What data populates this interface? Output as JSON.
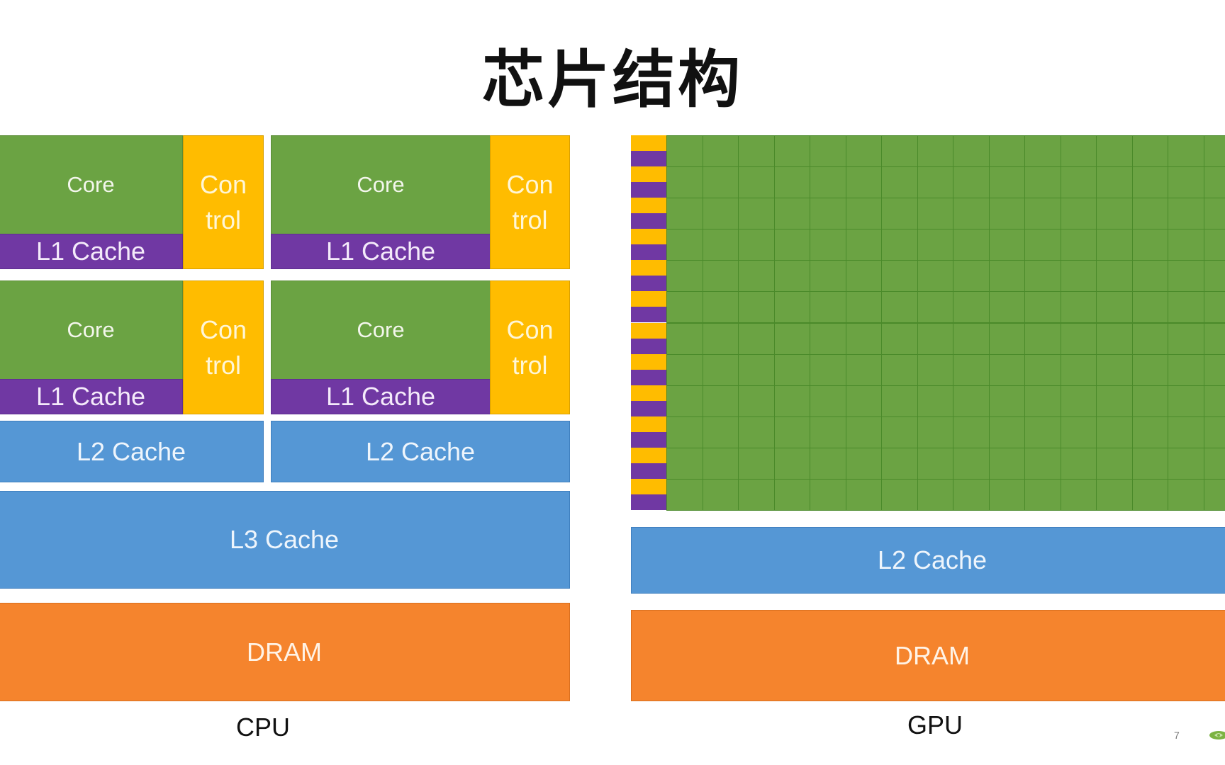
{
  "slide": {
    "title": "芯片结构",
    "page_number": "7"
  },
  "colors": {
    "core": "#6ba343",
    "l1_cache": "#7038a3",
    "control": "#ffbc00",
    "cache": "#5597d5",
    "dram": "#f5842d",
    "grid_line": "#4a8a2a"
  },
  "cpu": {
    "caption": "CPU",
    "cores": [
      {
        "core": "Core",
        "l1": "L1 Cache",
        "control_top": "Con",
        "control_bottom": "trol"
      },
      {
        "core": "Core",
        "l1": "L1 Cache",
        "control_top": "Con",
        "control_bottom": "trol"
      },
      {
        "core": "Core",
        "l1": "L1 Cache",
        "control_top": "Con",
        "control_bottom": "trol"
      },
      {
        "core": "Core",
        "l1": "L1 Cache",
        "control_top": "Con",
        "control_bottom": "trol"
      }
    ],
    "l2": [
      "L2 Cache",
      "L2 Cache"
    ],
    "l3": "L3 Cache",
    "dram": "DRAM"
  },
  "gpu": {
    "caption": "GPU",
    "grid_rows": 12,
    "grid_cols_visible": 17,
    "l2": "L2 Cache",
    "dram": "DRAM"
  },
  "icons": {
    "logo": "nvidia-logo-icon"
  }
}
